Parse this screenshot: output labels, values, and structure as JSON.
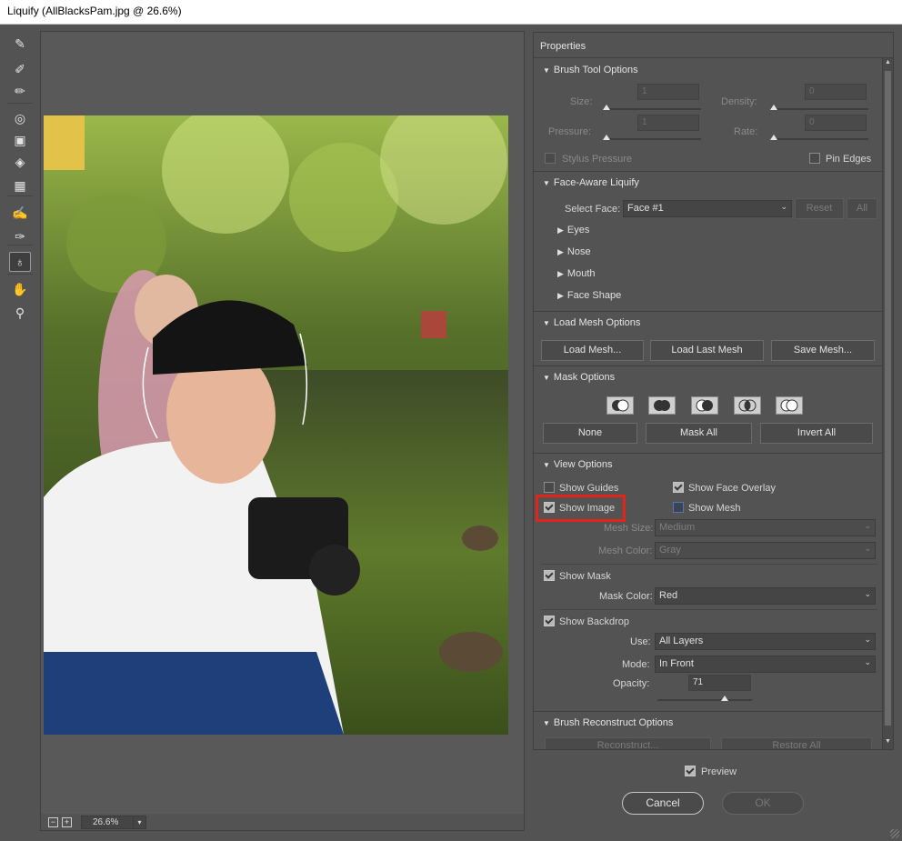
{
  "window": {
    "title": "Liquify (AllBlacksPam.jpg @ 26.6%)"
  },
  "tools": [
    {
      "name": "forward-warp-tool",
      "icon": "✎"
    },
    {
      "name": "reconstruct-tool",
      "icon": "✐"
    },
    {
      "name": "smooth-tool",
      "icon": "✏"
    },
    {
      "name": "twirl-tool",
      "icon": "◎"
    },
    {
      "name": "pucker-tool",
      "icon": "▣"
    },
    {
      "name": "bloat-tool",
      "icon": "◈"
    },
    {
      "name": "push-left-tool",
      "icon": "▦"
    },
    {
      "name": "freeze-mask-tool",
      "icon": "✍"
    },
    {
      "name": "thaw-mask-tool",
      "icon": "✑"
    },
    {
      "name": "face-tool",
      "icon": "♁"
    },
    {
      "name": "hand-tool",
      "icon": "✋"
    },
    {
      "name": "zoom-tool",
      "icon": "⚲"
    }
  ],
  "status": {
    "zoom": "26.6%",
    "zoom_out": "−",
    "zoom_in": "+"
  },
  "properties": {
    "title": "Properties",
    "brush": {
      "header": "Brush Tool Options",
      "size_label": "Size:",
      "size_value": "1",
      "density_label": "Density:",
      "density_value": "0",
      "pressure_label": "Pressure:",
      "pressure_value": "1",
      "rate_label": "Rate:",
      "rate_value": "0",
      "stylus_label": "Stylus Pressure",
      "pin_label": "Pin Edges"
    },
    "face": {
      "header": "Face-Aware Liquify",
      "select_label": "Select Face:",
      "select_value": "Face #1",
      "reset": "Reset",
      "all": "All",
      "groups": [
        "Eyes",
        "Nose",
        "Mouth",
        "Face Shape"
      ]
    },
    "mesh": {
      "header": "Load Mesh Options",
      "load": "Load Mesh...",
      "load_last": "Load Last Mesh",
      "save": "Save Mesh..."
    },
    "mask": {
      "header": "Mask Options",
      "none": "None",
      "mask_all": "Mask All",
      "invert_all": "Invert All"
    },
    "view": {
      "header": "View Options",
      "show_guides": "Show Guides",
      "show_face_overlay": "Show Face Overlay",
      "show_image": "Show Image",
      "show_mesh": "Show Mesh",
      "mesh_size_label": "Mesh Size:",
      "mesh_size_value": "Medium",
      "mesh_color_label": "Mesh Color:",
      "mesh_color_value": "Gray",
      "show_mask": "Show Mask",
      "mask_color_label": "Mask Color:",
      "mask_color_value": "Red",
      "show_backdrop": "Show Backdrop",
      "use_label": "Use:",
      "use_value": "All Layers",
      "mode_label": "Mode:",
      "mode_value": "In Front",
      "opacity_label": "Opacity:",
      "opacity_value": "71",
      "opacity_fraction": 0.71
    },
    "reconstruct": {
      "header": "Brush Reconstruct Options",
      "reconstruct": "Reconstruct...",
      "restore_all": "Restore All"
    }
  },
  "footer": {
    "preview": "Preview",
    "cancel": "Cancel",
    "ok": "OK"
  },
  "colors": {
    "highlight": "#e1251b",
    "panel": "#535353",
    "accent_check": "#b9b9b9"
  }
}
